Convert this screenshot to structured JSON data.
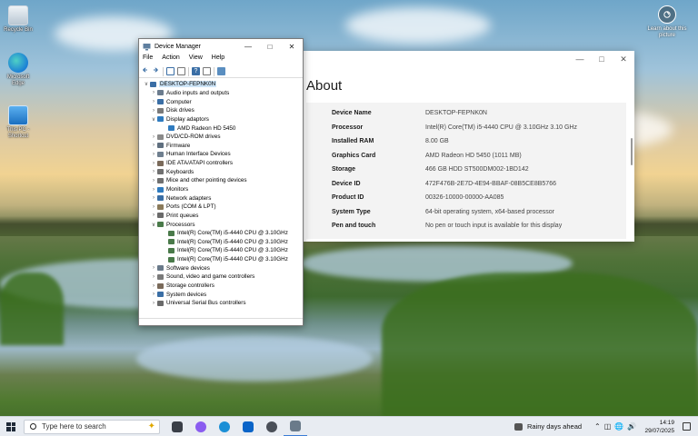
{
  "desktop": {
    "icons": [
      {
        "label": "Recycle Bin",
        "icon": "recycle-bin-icon"
      },
      {
        "label": "Microsoft Edge",
        "icon": "edge-icon"
      },
      {
        "label": "This PC - Shortcut",
        "icon": "this-pc-icon"
      }
    ],
    "learn_label": "Learn about this picture"
  },
  "about": {
    "heading": "About",
    "specs": [
      {
        "key": "Device Name",
        "value": "DESKTOP-FEPNK0N"
      },
      {
        "key": "Processor",
        "value": "Intel(R) Core(TM) i5-4440 CPU @ 3.10GHz   3.10 GHz"
      },
      {
        "key": "Installed RAM",
        "value": "8.00 GB"
      },
      {
        "key": "Graphics Card",
        "value": "AMD Radeon HD 5450 (1011 MB)"
      },
      {
        "key": "Storage",
        "value": "466 GB HDD ST500DM002-1BD142"
      },
      {
        "key": "Device ID",
        "value": "472F476B-2E7D-4E94-BBAF-08B5CE8B5766"
      },
      {
        "key": "Product ID",
        "value": "00326-10000-00000-AA085"
      },
      {
        "key": "System Type",
        "value": "64-bit operating system, x64-based processor"
      },
      {
        "key": "Pen and touch",
        "value": "No pen or touch input is available for this display"
      }
    ]
  },
  "device_manager": {
    "title": "Device Manager",
    "menu": [
      "File",
      "Action",
      "View",
      "Help"
    ],
    "tree": [
      {
        "label": "DESKTOP-FEPNK0N",
        "level": 0,
        "expander": "v",
        "color": "#3a6ea5"
      },
      {
        "label": "Audio inputs and outputs",
        "level": 1,
        "expander": ">",
        "color": "#6b7c8e"
      },
      {
        "label": "Computer",
        "level": 1,
        "expander": ">",
        "color": "#3a6ea5"
      },
      {
        "label": "Disk drives",
        "level": 1,
        "expander": ">",
        "color": "#7a7a7a"
      },
      {
        "label": "Display adaptors",
        "level": 1,
        "expander": "v",
        "color": "#2f7bbf"
      },
      {
        "label": "AMD Radeon HD 5450",
        "level": 2,
        "expander": "",
        "color": "#2f7bbf"
      },
      {
        "label": "DVD/CD-ROM drives",
        "level": 1,
        "expander": ">",
        "color": "#8a8a8a"
      },
      {
        "label": "Firmware",
        "level": 1,
        "expander": ">",
        "color": "#5f6f7f"
      },
      {
        "label": "Human Interface Devices",
        "level": 1,
        "expander": ">",
        "color": "#6f7f8f"
      },
      {
        "label": "IDE ATA/ATAPI controllers",
        "level": 1,
        "expander": ">",
        "color": "#7a6a5a"
      },
      {
        "label": "Keyboards",
        "level": 1,
        "expander": ">",
        "color": "#707070"
      },
      {
        "label": "Mice and other pointing devices",
        "level": 1,
        "expander": ">",
        "color": "#707070"
      },
      {
        "label": "Monitors",
        "level": 1,
        "expander": ">",
        "color": "#2f7bbf"
      },
      {
        "label": "Network adapters",
        "level": 1,
        "expander": ">",
        "color": "#3a6ea5"
      },
      {
        "label": "Ports (COM & LPT)",
        "level": 1,
        "expander": ">",
        "color": "#8a7a5a"
      },
      {
        "label": "Print queues",
        "level": 1,
        "expander": ">",
        "color": "#6a6a6a"
      },
      {
        "label": "Processors",
        "level": 1,
        "expander": "v",
        "color": "#4a7a4a"
      },
      {
        "label": "Intel(R) Core(TM) i5-4440 CPU @ 3.10GHz",
        "level": 2,
        "expander": "",
        "color": "#4a7a4a"
      },
      {
        "label": "Intel(R) Core(TM) i5-4440 CPU @ 3.10GHz",
        "level": 2,
        "expander": "",
        "color": "#4a7a4a"
      },
      {
        "label": "Intel(R) Core(TM) i5-4440 CPU @ 3.10GHz",
        "level": 2,
        "expander": "",
        "color": "#4a7a4a"
      },
      {
        "label": "Intel(R) Core(TM) i5-4440 CPU @ 3.10GHz",
        "level": 2,
        "expander": "",
        "color": "#4a7a4a"
      },
      {
        "label": "Software devices",
        "level": 1,
        "expander": ">",
        "color": "#6a7a8a"
      },
      {
        "label": "Sound, video and game controllers",
        "level": 1,
        "expander": ">",
        "color": "#7a7a7a"
      },
      {
        "label": "Storage controllers",
        "level": 1,
        "expander": ">",
        "color": "#7a6a5a"
      },
      {
        "label": "System devices",
        "level": 1,
        "expander": ">",
        "color": "#3a6ea5"
      },
      {
        "label": "Universal Serial Bus controllers",
        "level": 1,
        "expander": ">",
        "color": "#6a6a6a"
      }
    ]
  },
  "taskbar": {
    "search_placeholder": "Type here to search",
    "apps": [
      {
        "icon": "task-view-icon",
        "color": "#3a3f48"
      },
      {
        "icon": "copilot-icon",
        "color": "#8a5cf0"
      },
      {
        "icon": "edge-icon",
        "color": "#1b8fd6"
      },
      {
        "icon": "outlook-icon",
        "color": "#0a64c8"
      },
      {
        "icon": "settings-icon",
        "color": "#4a4f58"
      },
      {
        "icon": "device-manager-icon",
        "color": "#6a7a8a"
      }
    ],
    "weather": "Rainy days ahead",
    "time": "14:19",
    "date": "29/07/2025"
  }
}
